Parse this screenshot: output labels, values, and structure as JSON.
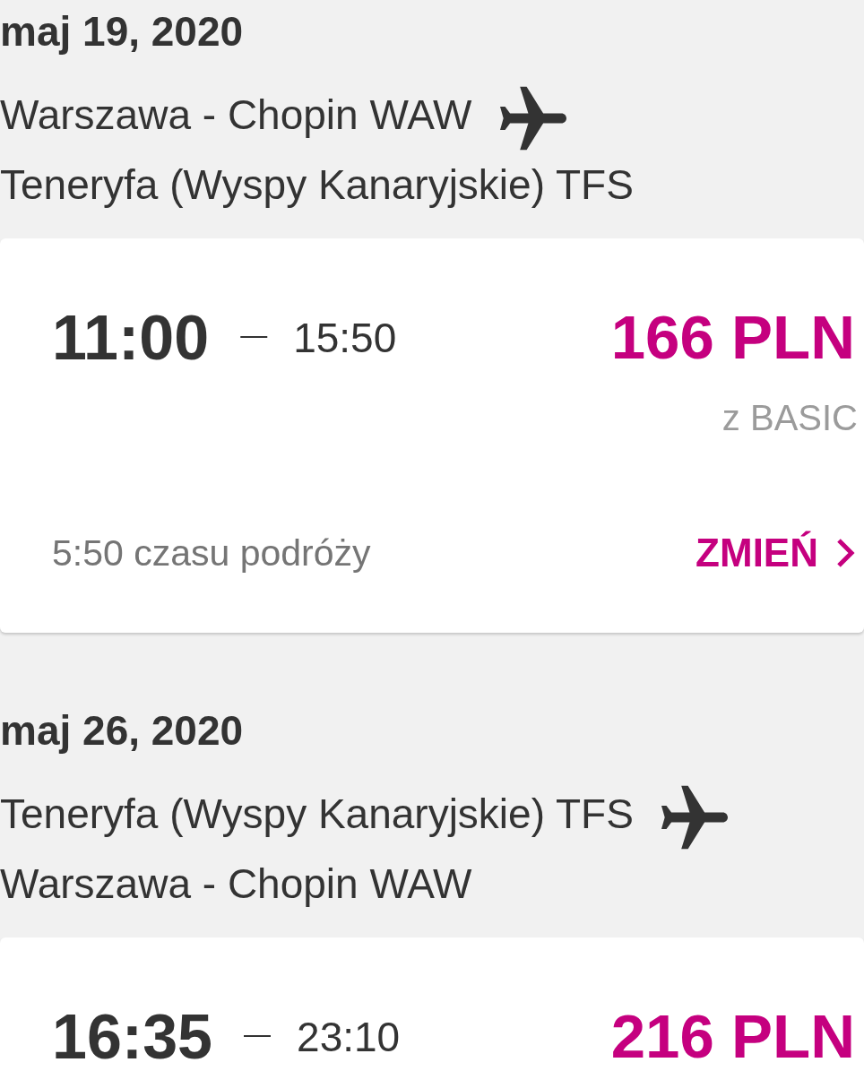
{
  "flights": [
    {
      "date": "maj 19, 2020",
      "from": "Warszawa - Chopin WAW",
      "to": "Teneryfa (Wyspy Kanaryjskie) TFS",
      "departure": "11:00",
      "dash": "—",
      "arrival": "15:50",
      "price": "166 PLN",
      "fare": "z BASIC",
      "duration": "5:50 czasu podróży",
      "action": "ZMIEŃ"
    },
    {
      "date": "maj 26, 2020",
      "from": "Teneryfa (Wyspy Kanaryjskie) TFS",
      "to": "Warszawa - Chopin WAW",
      "departure": "16:35",
      "dash": "—",
      "arrival": "23:10",
      "price": "216 PLN"
    }
  ]
}
